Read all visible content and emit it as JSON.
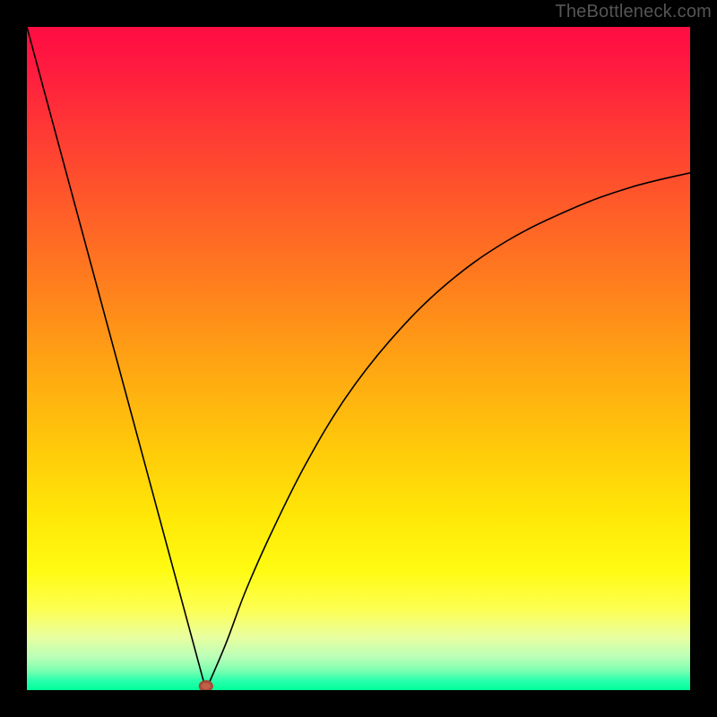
{
  "watermark": "TheBottleneck.com",
  "chart_data": {
    "type": "line",
    "title": "",
    "xlabel": "",
    "ylabel": "",
    "xlim": [
      0,
      100
    ],
    "ylim": [
      0,
      100
    ],
    "grid": false,
    "legend": false,
    "annotations": [],
    "vertex": {
      "x": 27,
      "y": 0
    },
    "left_branch_top": {
      "x": 0,
      "y": 100
    },
    "right_branch_end": {
      "x": 100,
      "y": 78
    },
    "series": [
      {
        "name": "left-branch",
        "x": [
          0.0,
          2.7,
          5.4,
          8.1,
          10.8,
          13.5,
          16.2,
          18.9,
          21.6,
          24.3,
          27.0
        ],
        "y": [
          100.0,
          90.0,
          80.0,
          70.0,
          60.0,
          50.0,
          40.0,
          30.0,
          20.0,
          10.0,
          0.0
        ]
      },
      {
        "name": "right-branch",
        "x": [
          27.0,
          30.0,
          33.0,
          37.0,
          42.0,
          48.0,
          55.0,
          63.0,
          72.0,
          82.0,
          91.0,
          100.0
        ],
        "y": [
          0.0,
          7.0,
          15.0,
          24.0,
          34.0,
          44.0,
          53.0,
          61.0,
          67.5,
          72.5,
          75.8,
          78.0
        ]
      }
    ],
    "background_gradient": {
      "orientation": "vertical",
      "stops": [
        {
          "pos": 0.0,
          "color": "#ff0d43"
        },
        {
          "pos": 0.28,
          "color": "#ff5e28"
        },
        {
          "pos": 0.52,
          "color": "#ffa812"
        },
        {
          "pos": 0.82,
          "color": "#fffb12"
        },
        {
          "pos": 0.95,
          "color": "#baffb8"
        },
        {
          "pos": 1.0,
          "color": "#00ff99"
        }
      ]
    },
    "marker": {
      "color": "#c0604a",
      "radius_px": 6
    }
  }
}
